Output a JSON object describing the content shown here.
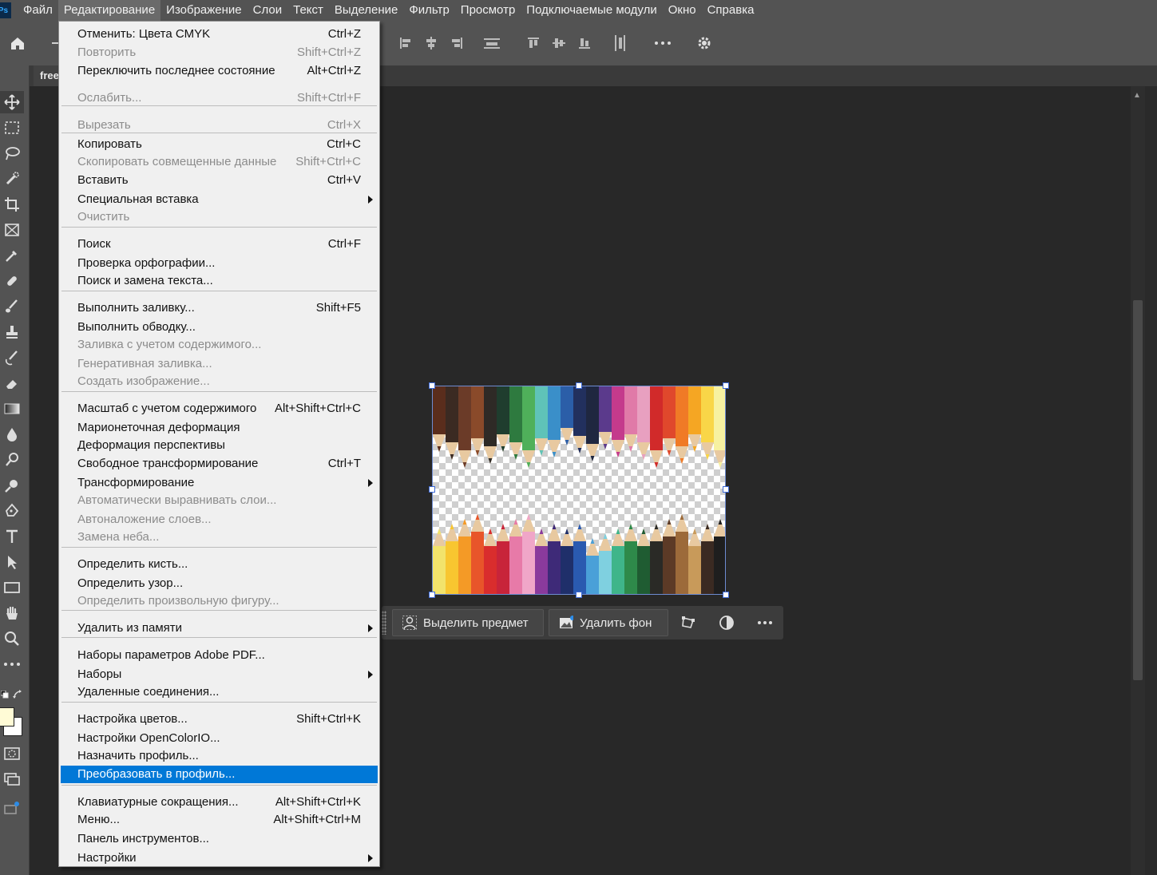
{
  "app": {
    "logo_text": "Ps"
  },
  "menubar": {
    "items": [
      {
        "label": "Файл",
        "active": false
      },
      {
        "label": "Редактирование",
        "active": true
      },
      {
        "label": "Изображение",
        "active": false
      },
      {
        "label": "Слои",
        "active": false
      },
      {
        "label": "Текст",
        "active": false
      },
      {
        "label": "Выделение",
        "active": false
      },
      {
        "label": "Фильтр",
        "active": false
      },
      {
        "label": "Просмотр",
        "active": false
      },
      {
        "label": "Подключаемые модули",
        "active": false
      },
      {
        "label": "Окно",
        "active": false
      },
      {
        "label": "Справка",
        "active": false
      }
    ]
  },
  "document": {
    "tab_label": "free"
  },
  "edit_menu": {
    "items": [
      {
        "label": "Отменить: Цвета CMYK",
        "shortcut": "Ctrl+Z",
        "disabled": false,
        "submenu": false
      },
      {
        "label": "Повторить",
        "shortcut": "Shift+Ctrl+Z",
        "disabled": true,
        "submenu": false
      },
      {
        "label": "Переключить последнее состояние",
        "shortcut": "Alt+Ctrl+Z",
        "disabled": false,
        "submenu": false
      },
      {
        "sep": true
      },
      {
        "label": "Ослабить...",
        "shortcut": "Shift+Ctrl+F",
        "disabled": true,
        "submenu": false
      },
      {
        "sep": true
      },
      {
        "label": "Вырезать",
        "shortcut": "Ctrl+X",
        "disabled": true,
        "submenu": false
      },
      {
        "label": "Копировать",
        "shortcut": "Ctrl+C",
        "disabled": false,
        "submenu": false
      },
      {
        "label": "Скопировать совмещенные данные",
        "shortcut": "Shift+Ctrl+C",
        "disabled": true,
        "submenu": false
      },
      {
        "label": "Вставить",
        "shortcut": "Ctrl+V",
        "disabled": false,
        "submenu": false
      },
      {
        "label": "Специальная вставка",
        "shortcut": "",
        "disabled": false,
        "submenu": true
      },
      {
        "label": "Очистить",
        "shortcut": "",
        "disabled": true,
        "submenu": false
      },
      {
        "sep": true
      },
      {
        "label": "Поиск",
        "shortcut": "Ctrl+F",
        "disabled": false,
        "submenu": false
      },
      {
        "label": "Проверка орфографии...",
        "shortcut": "",
        "disabled": false,
        "submenu": false
      },
      {
        "label": "Поиск и замена текста...",
        "shortcut": "",
        "disabled": false,
        "submenu": false
      },
      {
        "sep": true
      },
      {
        "label": "Выполнить заливку...",
        "shortcut": "Shift+F5",
        "disabled": false,
        "submenu": false
      },
      {
        "label": "Выполнить обводку...",
        "shortcut": "",
        "disabled": false,
        "submenu": false
      },
      {
        "label": "Заливка с учетом содержимого...",
        "shortcut": "",
        "disabled": true,
        "submenu": false
      },
      {
        "label": "Генеративная заливка...",
        "shortcut": "",
        "disabled": true,
        "submenu": false
      },
      {
        "label": "Создать изображение...",
        "shortcut": "",
        "disabled": true,
        "submenu": false
      },
      {
        "sep": true
      },
      {
        "label": "Масштаб с учетом содержимого",
        "shortcut": "Alt+Shift+Ctrl+C",
        "disabled": false,
        "submenu": false
      },
      {
        "label": "Марионеточная деформация",
        "shortcut": "",
        "disabled": false,
        "submenu": false
      },
      {
        "label": "Деформация перспективы",
        "shortcut": "",
        "disabled": false,
        "submenu": false
      },
      {
        "label": "Свободное трансформирование",
        "shortcut": "Ctrl+T",
        "disabled": false,
        "submenu": false
      },
      {
        "label": "Трансформирование",
        "shortcut": "",
        "disabled": false,
        "submenu": true
      },
      {
        "label": "Автоматически выравнивать слои...",
        "shortcut": "",
        "disabled": true,
        "submenu": false
      },
      {
        "label": "Автоналожение слоев...",
        "shortcut": "",
        "disabled": true,
        "submenu": false
      },
      {
        "label": "Замена неба...",
        "shortcut": "",
        "disabled": true,
        "submenu": false
      },
      {
        "sep": true
      },
      {
        "label": "Определить кисть...",
        "shortcut": "",
        "disabled": false,
        "submenu": false
      },
      {
        "label": "Определить узор...",
        "shortcut": "",
        "disabled": false,
        "submenu": false
      },
      {
        "label": "Определить произвольную фигуру...",
        "shortcut": "",
        "disabled": true,
        "submenu": false
      },
      {
        "sep": true
      },
      {
        "label": "Удалить из памяти",
        "shortcut": "",
        "disabled": false,
        "submenu": true
      },
      {
        "sep": true
      },
      {
        "label": "Наборы параметров Adobe PDF...",
        "shortcut": "",
        "disabled": false,
        "submenu": false
      },
      {
        "label": "Наборы",
        "shortcut": "",
        "disabled": false,
        "submenu": true
      },
      {
        "label": "Удаленные соединения...",
        "shortcut": "",
        "disabled": false,
        "submenu": false
      },
      {
        "sep": true
      },
      {
        "label": "Настройка цветов...",
        "shortcut": "Shift+Ctrl+K",
        "disabled": false,
        "submenu": false
      },
      {
        "label": "Настройки OpenColorIO...",
        "shortcut": "",
        "disabled": false,
        "submenu": false
      },
      {
        "label": "Назначить профиль...",
        "shortcut": "",
        "disabled": false,
        "submenu": false
      },
      {
        "label": "Преобразовать в профиль...",
        "shortcut": "",
        "disabled": false,
        "submenu": false,
        "highlighted": true
      },
      {
        "sep": true
      },
      {
        "label": "Клавиатурные сокращения...",
        "shortcut": "Alt+Shift+Ctrl+K",
        "disabled": false,
        "submenu": false
      },
      {
        "label": "Меню...",
        "shortcut": "Alt+Shift+Ctrl+M",
        "disabled": false,
        "submenu": false
      },
      {
        "label": "Панель инструментов...",
        "shortcut": "",
        "disabled": false,
        "submenu": false
      },
      {
        "label": "Настройки",
        "shortcut": "",
        "disabled": false,
        "submenu": true
      }
    ]
  },
  "contextual_taskbar": {
    "select_subject_label": "Выделить предмет",
    "remove_bg_label": "Удалить фон"
  },
  "colors": {
    "highlight": "#0078d7",
    "foreground_swatch": "#fffbd6",
    "background_swatch": "#ffffff",
    "selection_border": "#3d6ad6"
  },
  "pencils": {
    "top": [
      "#5a2d1c",
      "#3b2a22",
      "#6b3b28",
      "#8a4a2a",
      "#2e2a26",
      "#1f3d2e",
      "#2e7a3f",
      "#4fb05a",
      "#5fc3b8",
      "#3a8fc9",
      "#2b5ea8",
      "#22305e",
      "#1f2740",
      "#5b3a8c",
      "#c43a8c",
      "#e07aa8",
      "#e8a0c0",
      "#d12a2a",
      "#e0482c",
      "#f07a26",
      "#f5a623",
      "#f9d648",
      "#f7f1a0"
    ],
    "bottom": [
      "#f2e36b",
      "#f8c630",
      "#f49a26",
      "#e8552a",
      "#d92d2d",
      "#c8243a",
      "#e77aa8",
      "#f0a6c8",
      "#8a3a9c",
      "#3e2a78",
      "#1f2f6a",
      "#2a5ab0",
      "#4aa0d8",
      "#7fd0e0",
      "#3fb58a",
      "#2e8a4a",
      "#1f5c32",
      "#2a2a26",
      "#5c3a26",
      "#9c6a3a",
      "#c89a5a",
      "#3a2a22",
      "#1e1e1e"
    ]
  }
}
